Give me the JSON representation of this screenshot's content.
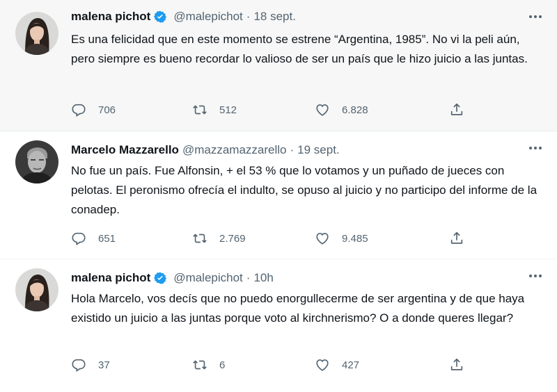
{
  "colors": {
    "verified": "#1d9bf0",
    "secondary_text": "#536471",
    "primary_text": "#0f1419",
    "highlight_bg": "#f7f7f7"
  },
  "tweets": [
    {
      "name": "malena pichot",
      "verified": true,
      "handle": "@malepichot",
      "separator": "·",
      "time": "18 sept.",
      "text": "Es una felicidad que en este momento se estrene “Argentina, 1985”. No vi la peli aún, pero siempre es bueno recordar lo valioso de ser un país que le hizo juicio a las juntas.",
      "replies": "706",
      "retweets": "512",
      "likes": "6.828",
      "icons": [
        "reply-icon",
        "retweet-icon",
        "like-icon",
        "share-icon"
      ]
    },
    {
      "name": "Marcelo Mazzarello",
      "verified": false,
      "handle": "@mazzamazzarello",
      "separator": "·",
      "time": "19 sept.",
      "text": "No fue un país. Fue Alfonsin, + el 53 % que lo votamos  y un puñado de jueces con pelotas. El peronismo ofrecía el indulto, se opuso al juicio  y no participo del informe de la conadep.",
      "replies": "651",
      "retweets": "2.769",
      "likes": "9.485",
      "icons": [
        "reply-icon",
        "retweet-icon",
        "like-icon",
        "share-icon"
      ]
    },
    {
      "name": "malena pichot",
      "verified": true,
      "handle": "@malepichot",
      "separator": "·",
      "time": "10h",
      "text": "Hola Marcelo, vos decís que no puedo enorgullecerme de ser argentina y de que haya existido un juicio a las juntas porque voto al kirchnerismo? O a donde queres llegar?",
      "replies": "37",
      "retweets": "6",
      "likes": "427",
      "icons": [
        "reply-icon",
        "retweet-icon",
        "like-icon",
        "share-icon"
      ]
    }
  ]
}
